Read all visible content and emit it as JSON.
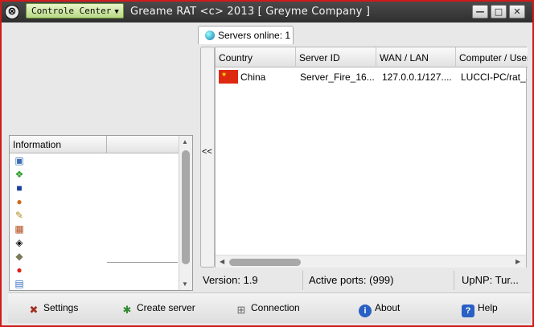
{
  "window": {
    "title": "Greame RAT <c> 2013 [ Greyme Company ]",
    "menu_button": "Controle Center",
    "minimize": "—",
    "maximize": "□",
    "close": "✕"
  },
  "info_panel": {
    "header": "Information",
    "icons": [
      "monitor-icon",
      "windows-icon",
      "desktop-icon",
      "user-icon",
      "tools-icon",
      "firewall-icon",
      "globe-icon",
      "chip-icon",
      "warning-icon",
      "drive-icon"
    ]
  },
  "servers_tab": {
    "label": "Servers online: 1",
    "collapse_label": "<<",
    "columns": [
      "Country",
      "Server ID",
      "WAN / LAN",
      "Computer / User"
    ],
    "rows": [
      {
        "country": "China",
        "server_id": "Server_Fire_16...",
        "wan_lan": "127.0.0.1/127....",
        "computer_user": "LUCCI-PC/rat_..."
      }
    ]
  },
  "status": {
    "version": "Version: 1.9",
    "active_ports": "Active ports: (999)",
    "upnp": "UpNP: Tur..."
  },
  "toolbar": {
    "settings": "Settings",
    "create_server": "Create server",
    "connection": "Connection",
    "about": "About",
    "help": "Help"
  }
}
